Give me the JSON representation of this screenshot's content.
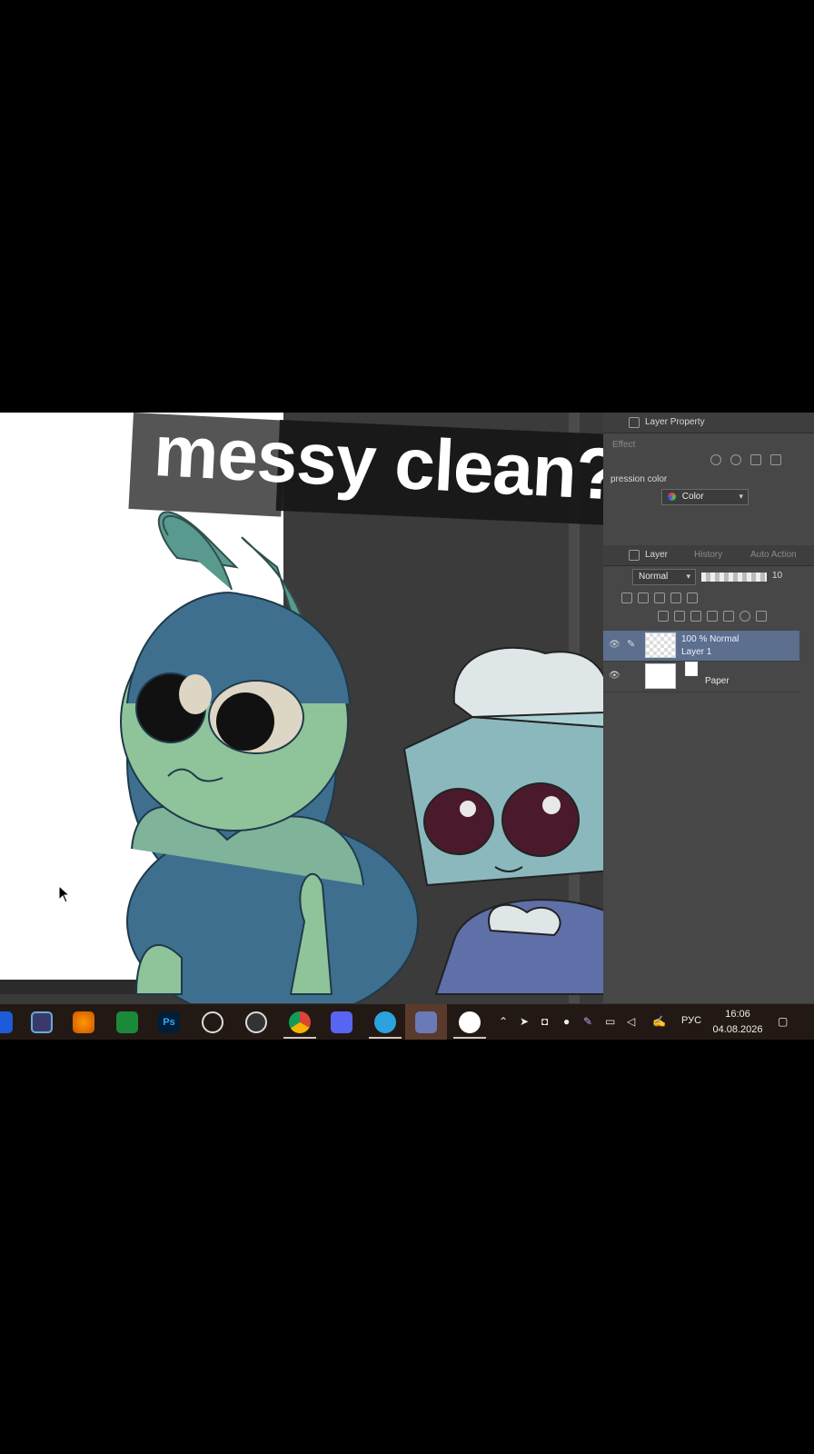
{
  "overlay": {
    "title": "messy clean?"
  },
  "panel": {
    "property_tab": "Layer Property",
    "effect_label": "Effect",
    "expression_label": "pression color",
    "expression_value": "Color",
    "layer_tab": "Layer",
    "history_tab": "History",
    "auto_action_tab": "Auto Action",
    "blend_mode": "Normal",
    "opacity_value": "10",
    "layers": [
      {
        "meta": "100 % Normal",
        "name": "Layer 1"
      },
      {
        "name": "Paper"
      }
    ]
  },
  "taskbar": {
    "language": "РУС",
    "time": "16:06",
    "date": "04.08.2026",
    "apps": [
      "premiere-icon",
      "fl-studio-icon",
      "app-green-icon",
      "photoshop-icon",
      "obs-webcam-icon",
      "obs-icon",
      "chrome-icon",
      "discord-icon",
      "telegram-icon",
      "app-active-icon",
      "clip-studio-icon"
    ]
  },
  "colors": {
    "caterpillar_body": "#8fc39a",
    "caterpillar_blue": "#3f6f8f",
    "tissue_box": "#8ab8bd",
    "eye_dark": "#4a1a2c",
    "layer_selected": "#5c6f8e"
  }
}
